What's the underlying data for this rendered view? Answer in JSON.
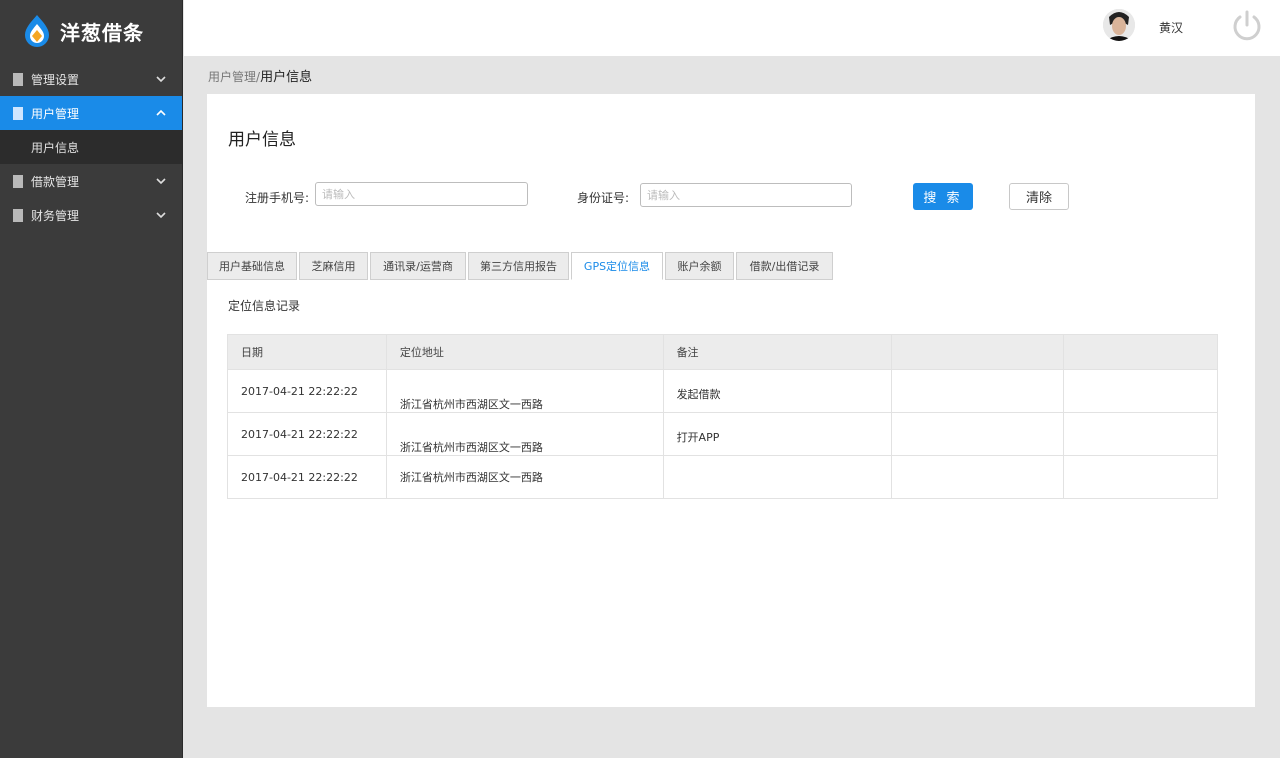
{
  "app": {
    "name": "洋葱借条"
  },
  "sidebar": {
    "items": [
      {
        "label": "管理设置"
      },
      {
        "label": "用户管理"
      },
      {
        "label": "借款管理"
      },
      {
        "label": "财务管理"
      }
    ],
    "sub_items": [
      {
        "label": "用户信息"
      }
    ]
  },
  "header": {
    "username": "黄汉"
  },
  "breadcrumb": {
    "parent": "用户管理",
    "separator": "/",
    "current": "用户信息"
  },
  "panel": {
    "title": "用户信息"
  },
  "search": {
    "phone_label": "注册手机号:",
    "phone_placeholder": "请输入",
    "id_label": "身份证号:",
    "id_placeholder": "请输入",
    "search_label": "搜 索",
    "clear_label": "清除"
  },
  "tabs": [
    {
      "label": "用户基础信息"
    },
    {
      "label": "芝麻信用"
    },
    {
      "label": "通讯录/运营商"
    },
    {
      "label": "第三方信用报告"
    },
    {
      "label": "GPS定位信息"
    },
    {
      "label": "账户余额"
    },
    {
      "label": "借款/出借记录"
    }
  ],
  "section": {
    "title": "定位信息记录"
  },
  "table": {
    "headers": [
      "日期",
      "定位地址",
      "备注",
      "",
      ""
    ],
    "rows": [
      [
        "2017-04-21 22:22:22",
        "浙江省杭州市西湖区文一西路",
        "发起借款",
        "",
        ""
      ],
      [
        "2017-04-21 22:22:22",
        "浙江省杭州市西湖区文一西路",
        "打开APP",
        "",
        ""
      ],
      [
        "2017-04-21 22:22:22",
        "浙江省杭州市西湖区文一西路",
        "",
        "",
        ""
      ]
    ]
  },
  "colors": {
    "accent": "#1a8be8",
    "sidebar_bg": "#3b3b3b",
    "sub_bg": "#2c2c2c"
  },
  "icons": {
    "logo": "flame-drop-icon",
    "chevron": "chevron-icon",
    "power": "power-icon"
  }
}
